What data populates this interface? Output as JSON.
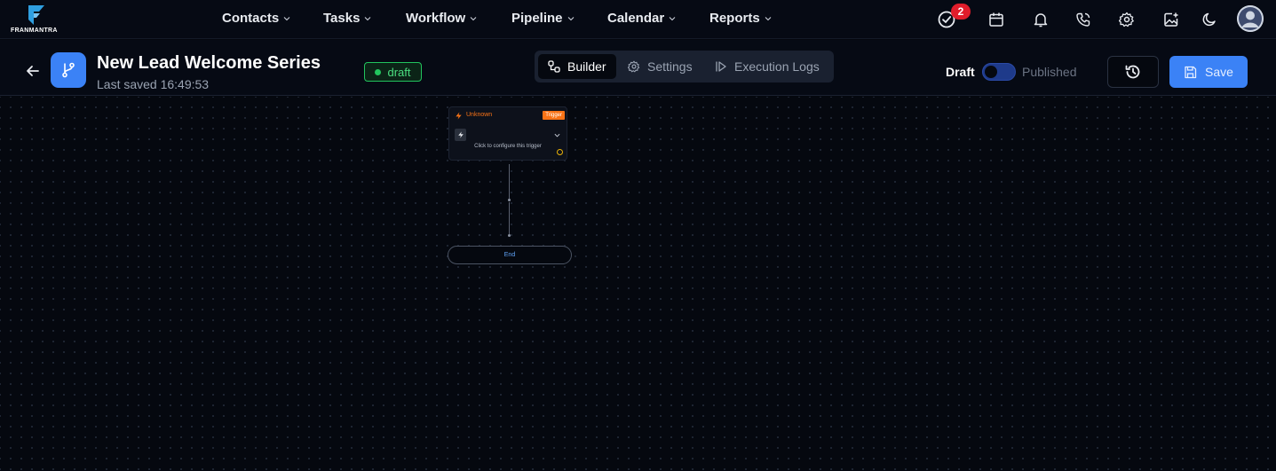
{
  "brand": {
    "name": "FRANMANTRA",
    "logo_color": "#2f9fe0"
  },
  "nav": {
    "items": [
      {
        "label": "Contacts"
      },
      {
        "label": "Tasks"
      },
      {
        "label": "Workflow"
      },
      {
        "label": "Pipeline"
      },
      {
        "label": "Calendar"
      },
      {
        "label": "Reports"
      }
    ],
    "notifications_count": "2",
    "icons": [
      "check-circle-icon",
      "calendar-icon",
      "bell-icon",
      "phone-icon",
      "gear-icon",
      "image-upload-icon",
      "moon-icon",
      "user-avatar-icon"
    ]
  },
  "workflow": {
    "title": "New Lead Welcome Series",
    "last_saved": "Last saved 16:49:53",
    "status": "draft",
    "status_color": "#22c55e",
    "icon": "git-branch-icon",
    "accent_color": "#3b82f6"
  },
  "tabs": [
    {
      "label": "Builder",
      "icon": "nodes-icon",
      "active": true
    },
    {
      "label": "Settings",
      "icon": "gear-icon",
      "active": false
    },
    {
      "label": "Execution Logs",
      "icon": "play-outline-icon",
      "active": false
    }
  ],
  "publish": {
    "draft_label": "Draft",
    "published_label": "Published",
    "published": false
  },
  "actions": {
    "history_icon": "history-icon",
    "save_label": "Save",
    "save_icon": "save-icon"
  },
  "canvas": {
    "trigger": {
      "title": "Unknown",
      "badge": "Trigger",
      "hint": "Click to configure this trigger",
      "color": "#f97316"
    },
    "end_label": "End"
  }
}
